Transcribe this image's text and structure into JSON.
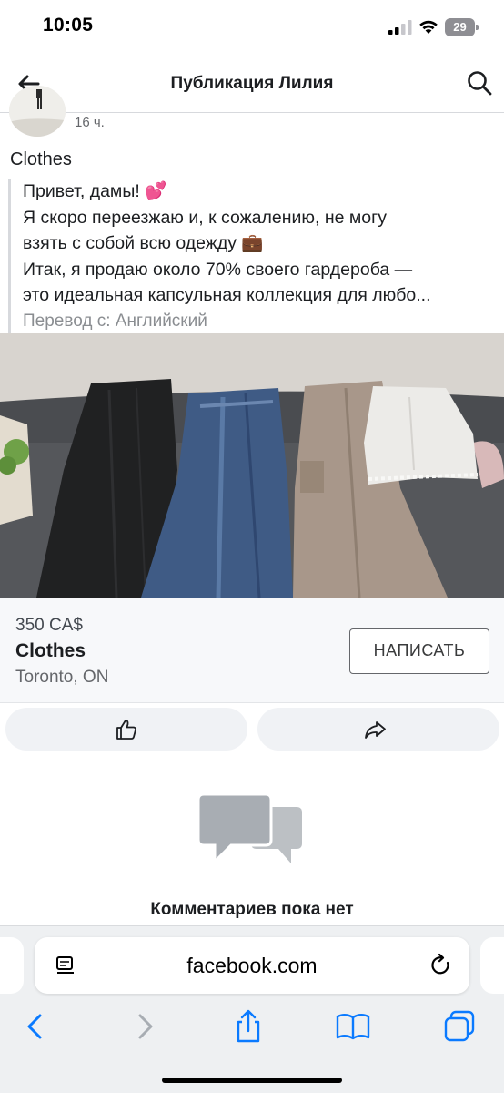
{
  "status_bar": {
    "time": "10:05",
    "battery": "29"
  },
  "nav": {
    "title": "Публикация Лилия",
    "back_icon": "back-arrow-icon",
    "search_icon": "search-icon"
  },
  "post": {
    "time": "16 ч.",
    "title": "Clothes",
    "lines": [
      "Привет, дамы! 💕",
      "Я скоро переезжаю и, к сожалению, не могу",
      "взять с собой всю одежду 💼",
      "Итак, я продаю около 70% своего гардероба —",
      "это идеальная капсульная коллекция для любо..."
    ],
    "translation_note": "Перевод с: Английский"
  },
  "listing": {
    "price": "350 CA$",
    "title": "Clothes",
    "location": "Toronto, ON",
    "message_button": "НАПИСАТЬ"
  },
  "actions": {
    "like_icon": "thumbs-up-icon",
    "share_icon": "share-arrow-icon"
  },
  "comments": {
    "empty_text": "Комментариев пока нет",
    "icon": "chat-bubbles-icon"
  },
  "browser": {
    "url": "facebook.com"
  },
  "colors": {
    "accent_gray": "#65676b",
    "surface": "#f0f2f5",
    "safari_blue": "#0a7aff"
  }
}
